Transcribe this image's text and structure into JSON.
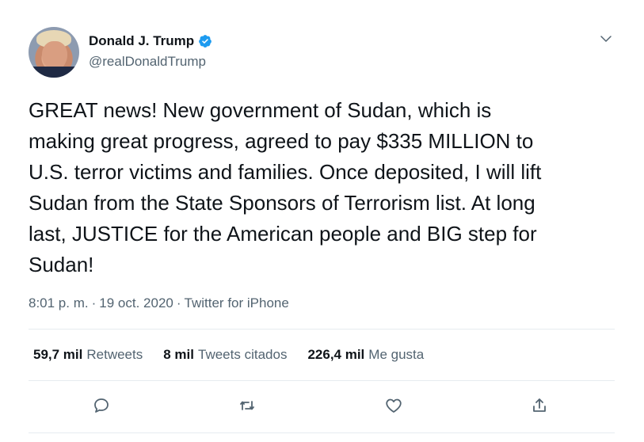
{
  "user": {
    "display_name": "Donald J. Trump",
    "handle": "@realDonaldTrump",
    "verified": true
  },
  "tweet": {
    "text": "GREAT news! New government of Sudan, which is\nmaking great progress, agreed to pay $335 MILLION to\nU.S. terror victims and families. Once deposited, I will lift\nSudan from the State Sponsors of Terrorism list. At long\nlast, JUSTICE for the American people and BIG step for\nSudan!",
    "time": "8:01 p. m.",
    "separator1": "·",
    "date": "19 oct. 2020",
    "separator2": "·",
    "source": "Twitter for iPhone"
  },
  "stats": {
    "retweets_count": "59,7 mil",
    "retweets_label": "Retweets",
    "quotes_count": "8 mil",
    "quotes_label": "Tweets citados",
    "likes_count": "226,4 mil",
    "likes_label": "Me gusta"
  },
  "icons": {
    "verified": "verified-badge-icon",
    "menu": "chevron-down-icon",
    "reply": "reply-icon",
    "retweet": "retweet-icon",
    "like": "heart-icon",
    "share": "share-icon"
  },
  "colors": {
    "verified": "#1d9bf0",
    "text": "#0f1419",
    "secondary": "#536471",
    "divider": "#e6ecf0"
  }
}
